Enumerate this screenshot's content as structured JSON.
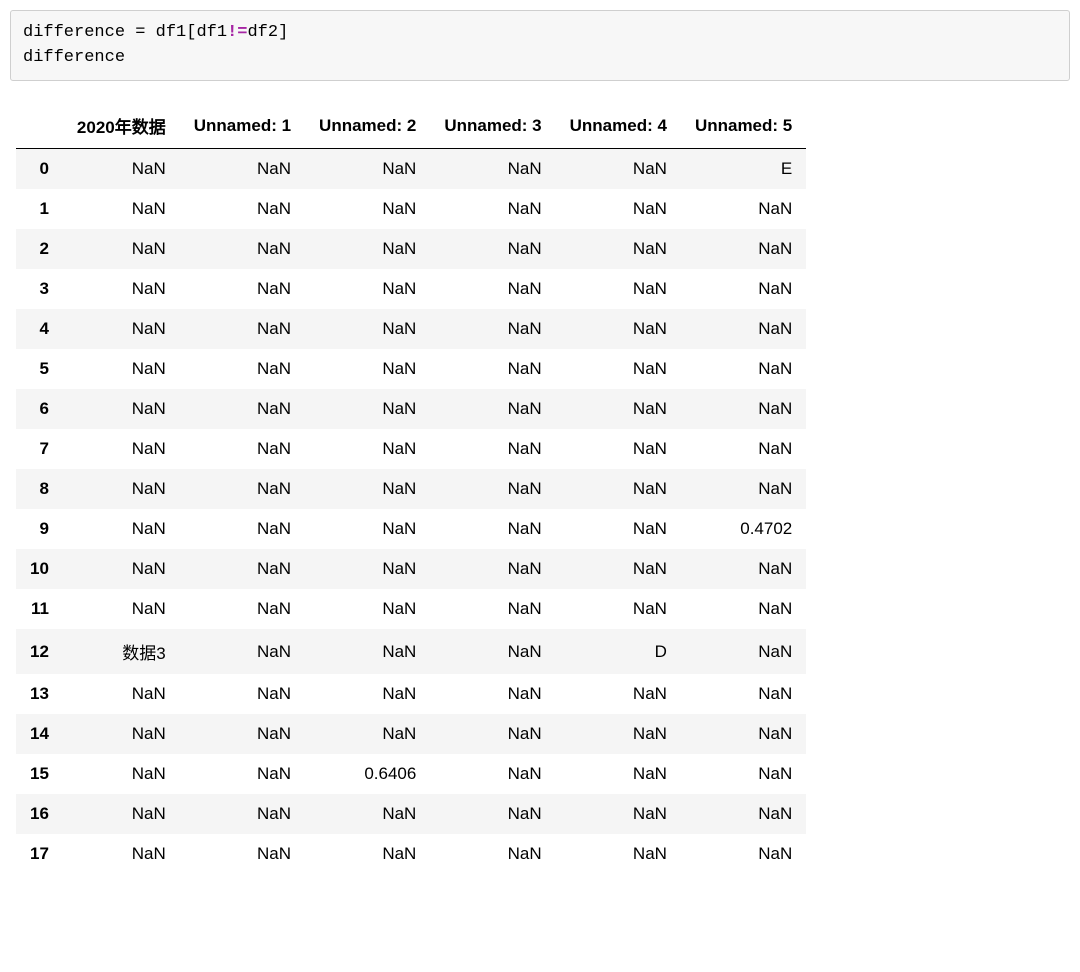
{
  "code": {
    "line1": {
      "var": "difference",
      "eq": " = ",
      "df1a": "df1",
      "lbrk": "[",
      "df1b": "df1",
      "neq": "!=",
      "df2": "df2",
      "rbrk": "]"
    },
    "line2": "difference"
  },
  "table": {
    "columns": [
      "2020年数据",
      "Unnamed: 1",
      "Unnamed: 2",
      "Unnamed: 3",
      "Unnamed: 4",
      "Unnamed: 5"
    ],
    "rows": [
      {
        "idx": "0",
        "c": [
          "NaN",
          "NaN",
          "NaN",
          "NaN",
          "NaN",
          "E"
        ]
      },
      {
        "idx": "1",
        "c": [
          "NaN",
          "NaN",
          "NaN",
          "NaN",
          "NaN",
          "NaN"
        ]
      },
      {
        "idx": "2",
        "c": [
          "NaN",
          "NaN",
          "NaN",
          "NaN",
          "NaN",
          "NaN"
        ]
      },
      {
        "idx": "3",
        "c": [
          "NaN",
          "NaN",
          "NaN",
          "NaN",
          "NaN",
          "NaN"
        ]
      },
      {
        "idx": "4",
        "c": [
          "NaN",
          "NaN",
          "NaN",
          "NaN",
          "NaN",
          "NaN"
        ]
      },
      {
        "idx": "5",
        "c": [
          "NaN",
          "NaN",
          "NaN",
          "NaN",
          "NaN",
          "NaN"
        ]
      },
      {
        "idx": "6",
        "c": [
          "NaN",
          "NaN",
          "NaN",
          "NaN",
          "NaN",
          "NaN"
        ]
      },
      {
        "idx": "7",
        "c": [
          "NaN",
          "NaN",
          "NaN",
          "NaN",
          "NaN",
          "NaN"
        ]
      },
      {
        "idx": "8",
        "c": [
          "NaN",
          "NaN",
          "NaN",
          "NaN",
          "NaN",
          "NaN"
        ]
      },
      {
        "idx": "9",
        "c": [
          "NaN",
          "NaN",
          "NaN",
          "NaN",
          "NaN",
          "0.4702"
        ]
      },
      {
        "idx": "10",
        "c": [
          "NaN",
          "NaN",
          "NaN",
          "NaN",
          "NaN",
          "NaN"
        ]
      },
      {
        "idx": "11",
        "c": [
          "NaN",
          "NaN",
          "NaN",
          "NaN",
          "NaN",
          "NaN"
        ]
      },
      {
        "idx": "12",
        "c": [
          "数据3",
          "NaN",
          "NaN",
          "NaN",
          "D",
          "NaN"
        ]
      },
      {
        "idx": "13",
        "c": [
          "NaN",
          "NaN",
          "NaN",
          "NaN",
          "NaN",
          "NaN"
        ]
      },
      {
        "idx": "14",
        "c": [
          "NaN",
          "NaN",
          "NaN",
          "NaN",
          "NaN",
          "NaN"
        ]
      },
      {
        "idx": "15",
        "c": [
          "NaN",
          "NaN",
          "0.6406",
          "NaN",
          "NaN",
          "NaN"
        ]
      },
      {
        "idx": "16",
        "c": [
          "NaN",
          "NaN",
          "NaN",
          "NaN",
          "NaN",
          "NaN"
        ]
      },
      {
        "idx": "17",
        "c": [
          "NaN",
          "NaN",
          "NaN",
          "NaN",
          "NaN",
          "NaN"
        ]
      }
    ]
  }
}
